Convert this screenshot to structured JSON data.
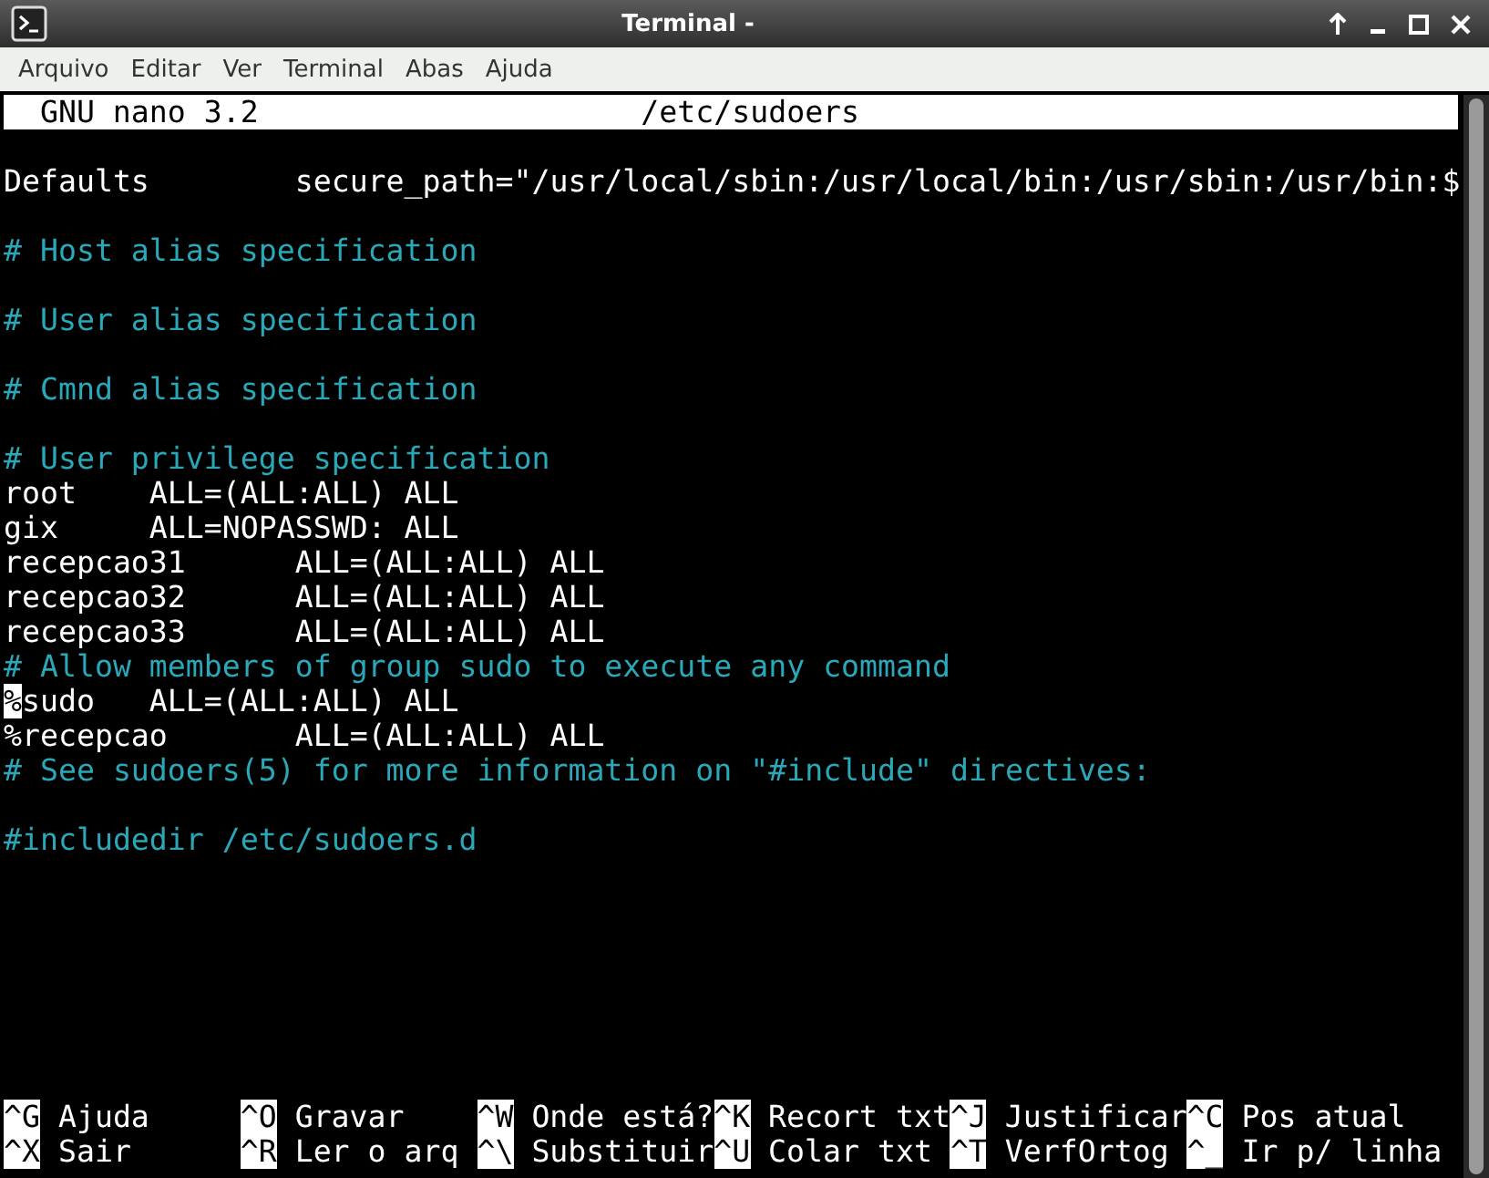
{
  "window": {
    "title": "Terminal -"
  },
  "menu": [
    "Arquivo",
    "Editar",
    "Ver",
    "Terminal",
    "Abas",
    "Ajuda"
  ],
  "header": {
    "program": "GNU nano 3.2",
    "file": "/etc/sudoers"
  },
  "lines": [
    {
      "kind": "blank"
    },
    {
      "kind": "code",
      "text": "Defaults        secure_path=\"/usr/local/sbin:/usr/local/bin:/usr/sbin:/usr/bin:$"
    },
    {
      "kind": "blank"
    },
    {
      "kind": "comment",
      "text": "# Host alias specification"
    },
    {
      "kind": "blank"
    },
    {
      "kind": "comment",
      "text": "# User alias specification"
    },
    {
      "kind": "blank"
    },
    {
      "kind": "comment",
      "text": "# Cmnd alias specification"
    },
    {
      "kind": "blank"
    },
    {
      "kind": "comment",
      "text": "# User privilege specification"
    },
    {
      "kind": "code",
      "text": "root    ALL=(ALL:ALL) ALL"
    },
    {
      "kind": "code",
      "text": "gix     ALL=NOPASSWD: ALL"
    },
    {
      "kind": "code",
      "text": "recepcao31      ALL=(ALL:ALL) ALL"
    },
    {
      "kind": "code",
      "text": "recepcao32      ALL=(ALL:ALL) ALL"
    },
    {
      "kind": "code",
      "text": "recepcao33      ALL=(ALL:ALL) ALL"
    },
    {
      "kind": "comment",
      "text": "# Allow members of group sudo to execute any command"
    },
    {
      "kind": "code",
      "text": "%sudo   ALL=(ALL:ALL) ALL",
      "cursor": true
    },
    {
      "kind": "code",
      "text": "%recepcao       ALL=(ALL:ALL) ALL"
    },
    {
      "kind": "comment",
      "text": "# See sudoers(5) for more information on \"#include\" directives:"
    },
    {
      "kind": "blank"
    },
    {
      "kind": "comment",
      "text": "#includedir /etc/sudoers.d"
    }
  ],
  "shortcuts": [
    [
      {
        "key": "^G",
        "label": "Ajuda"
      },
      {
        "key": "^O",
        "label": "Gravar"
      },
      {
        "key": "^W",
        "label": "Onde está?"
      },
      {
        "key": "^K",
        "label": "Recort txt"
      },
      {
        "key": "^J",
        "label": "Justificar"
      },
      {
        "key": "^C",
        "label": "Pos atual"
      }
    ],
    [
      {
        "key": "^X",
        "label": "Sair"
      },
      {
        "key": "^R",
        "label": "Ler o arq"
      },
      {
        "key": "^\\",
        "label": "Substituir"
      },
      {
        "key": "^U",
        "label": "Colar txt"
      },
      {
        "key": "^T",
        "label": "VerfOrtog"
      },
      {
        "key": "^_",
        "label": "Ir p/ linha"
      }
    ]
  ]
}
